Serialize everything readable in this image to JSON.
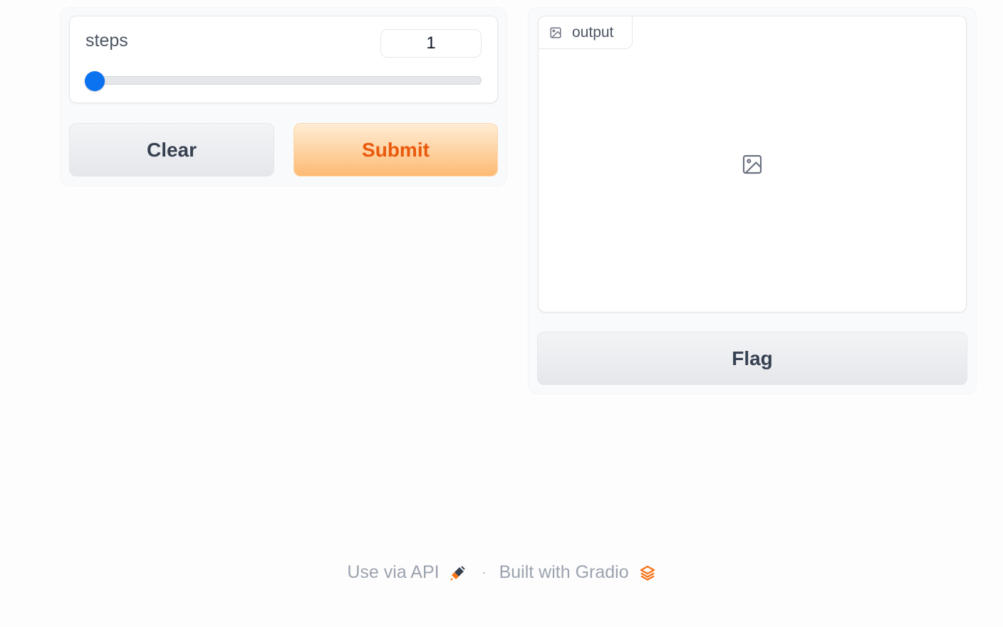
{
  "inputs": {
    "slider": {
      "label": "steps",
      "value": "1",
      "fraction": 0
    },
    "clear_label": "Clear",
    "submit_label": "Submit"
  },
  "outputs": {
    "image_label": "output",
    "flag_label": "Flag"
  },
  "footer": {
    "api_label": "Use via API",
    "separator": "·",
    "built_with_label": "Built with Gradio"
  },
  "colors": {
    "slider_accent": "#0b72f0",
    "primary_text": "#ea580c",
    "primary_gradient_end": "#fdba74",
    "secondary_bg": "#e5e7eb"
  },
  "icons": {
    "tab_icon": "image-icon",
    "placeholder_icon": "image-placeholder-icon",
    "api_icon": "rocket-plug-icon",
    "gradio_icon": "gradio-logo-icon"
  }
}
